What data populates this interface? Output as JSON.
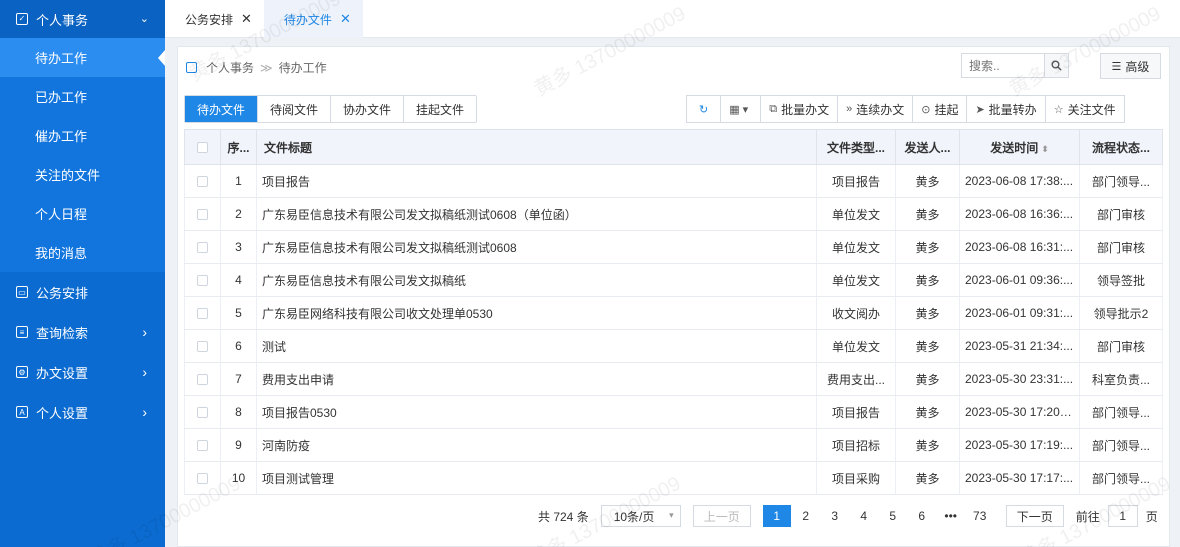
{
  "sidebar": {
    "group": {
      "label": "个人事务",
      "icon": "checkbox-icon",
      "chevron": "⌄"
    },
    "sub_items": [
      {
        "label": "待办工作",
        "active": true
      },
      {
        "label": "已办工作",
        "active": false
      },
      {
        "label": "催办工作",
        "active": false
      },
      {
        "label": "关注的文件",
        "active": false
      },
      {
        "label": "个人日程",
        "active": false
      },
      {
        "label": "我的消息",
        "active": false
      }
    ],
    "items": [
      {
        "label": "公务安排",
        "icon": "briefcase-icon",
        "chevron": ""
      },
      {
        "label": "查询检索",
        "icon": "search-doc-icon",
        "chevron": "›"
      },
      {
        "label": "办文设置",
        "icon": "settings-doc-icon",
        "chevron": "›"
      },
      {
        "label": "个人设置",
        "icon": "person-icon",
        "chevron": "›"
      }
    ]
  },
  "tabs": [
    {
      "label": "公务安排",
      "close": "✕",
      "active": false
    },
    {
      "label": "待办文件",
      "close": "✕",
      "active": true
    }
  ],
  "breadcrumb": {
    "root": "个人事务",
    "separator": "≫",
    "current": "待办工作"
  },
  "search": {
    "placeholder": "搜索..",
    "button_icon": "search-icon"
  },
  "advanced": {
    "label": "高级"
  },
  "file_tabs": [
    {
      "label": "待办文件",
      "active": true
    },
    {
      "label": "待阅文件",
      "active": false
    },
    {
      "label": "协办文件",
      "active": false
    },
    {
      "label": "挂起文件",
      "active": false
    }
  ],
  "toolbar": [
    {
      "label": "",
      "icon": "refresh-icon",
      "glyph": "↻"
    },
    {
      "label": "",
      "icon": "grid-view-icon",
      "glyph": "▦ ▾"
    },
    {
      "label": "批量办文",
      "icon": "copy-icon",
      "glyph": "⧉"
    },
    {
      "label": "连续办文",
      "icon": "double-chevron-icon",
      "glyph": "»"
    },
    {
      "label": "挂起",
      "icon": "pause-icon",
      "glyph": "⊙"
    },
    {
      "label": "批量转办",
      "icon": "send-icon",
      "glyph": "➤"
    },
    {
      "label": "关注文件",
      "icon": "star-icon",
      "glyph": "☆"
    }
  ],
  "table": {
    "columns": [
      "序...",
      "文件标题",
      "文件类型...",
      "发送人...",
      "发送时间",
      "流程状态..."
    ],
    "sort_glyph": "⬍",
    "rows": [
      {
        "no": "1",
        "title": "项目报告",
        "type": "项目报告",
        "sender": "黄多",
        "time": "2023-06-08 17:38:...",
        "status": "部门领导..."
      },
      {
        "no": "2",
        "title": "广东易臣信息技术有限公司发文拟稿纸测试0608（单位函）",
        "type": "单位发文",
        "sender": "黄多",
        "time": "2023-06-08 16:36:...",
        "status": "部门审核"
      },
      {
        "no": "3",
        "title": "广东易臣信息技术有限公司发文拟稿纸测试0608",
        "type": "单位发文",
        "sender": "黄多",
        "time": "2023-06-08 16:31:...",
        "status": "部门审核"
      },
      {
        "no": "4",
        "title": "广东易臣信息技术有限公司发文拟稿纸",
        "type": "单位发文",
        "sender": "黄多",
        "time": "2023-06-01 09:36:...",
        "status": "领导签批"
      },
      {
        "no": "5",
        "title": "广东易臣网络科技有限公司收文处理单0530",
        "type": "收文阅办",
        "sender": "黄多",
        "time": "2023-06-01 09:31:...",
        "status": "领导批示2"
      },
      {
        "no": "6",
        "title": "测试",
        "type": "单位发文",
        "sender": "黄多",
        "time": "2023-05-31 21:34:...",
        "status": "部门审核"
      },
      {
        "no": "7",
        "title": "费用支出申请",
        "type": "费用支出...",
        "sender": "黄多",
        "time": "2023-05-30 23:31:...",
        "status": "科室负责..."
      },
      {
        "no": "8",
        "title": "项目报告0530",
        "type": "项目报告",
        "sender": "黄多",
        "time": "2023-05-30 17:20:11",
        "status": "部门领导..."
      },
      {
        "no": "9",
        "title": "河南防疫",
        "type": "项目招标",
        "sender": "黄多",
        "time": "2023-05-30 17:19:...",
        "status": "部门领导..."
      },
      {
        "no": "10",
        "title": "项目测试管理",
        "type": "项目采购",
        "sender": "黄多",
        "time": "2023-05-30 17:17:...",
        "status": "部门领导..."
      }
    ]
  },
  "pagination": {
    "total": "共 724 条",
    "page_size": "10条/页",
    "prev": "上一页",
    "pages": [
      "1",
      "2",
      "3",
      "4",
      "5",
      "6",
      "•••",
      "73"
    ],
    "current": "1",
    "next": "下一页",
    "goto_prefix": "前往",
    "goto_value": "1",
    "goto_suffix": "页"
  },
  "watermark": "黄多 13700000009"
}
